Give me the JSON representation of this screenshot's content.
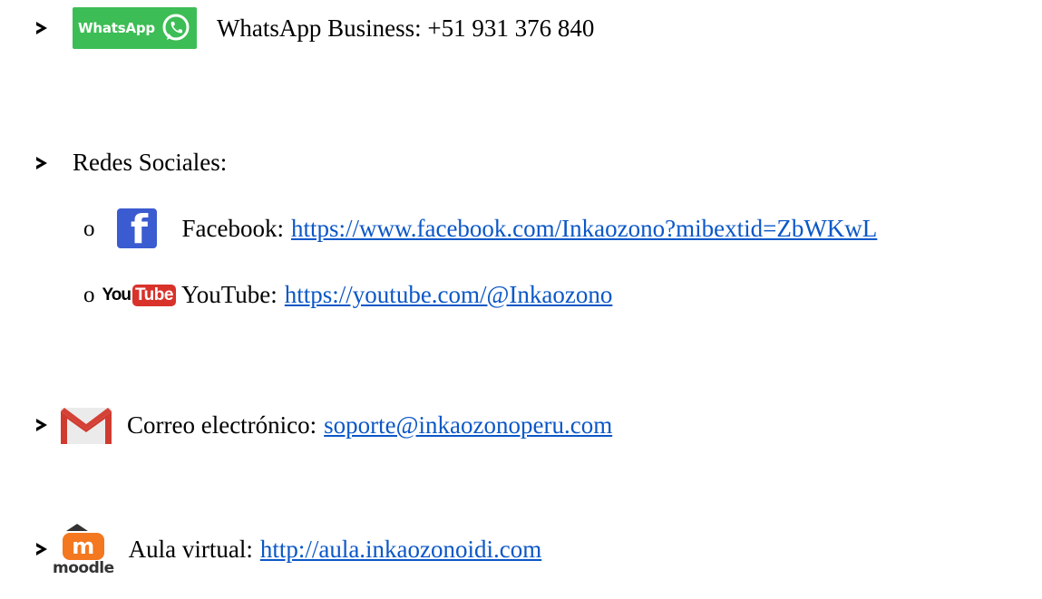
{
  "items": {
    "whatsapp": {
      "badge_label": "WhatsApp",
      "icon": "whatsapp-icon",
      "text": "WhatsApp Business: +51 931 376 840"
    },
    "social": {
      "heading": "Redes Sociales:",
      "sub_bullet": "o",
      "facebook": {
        "icon": "facebook-icon",
        "label": "Facebook:",
        "url": "https://www.facebook.com/Inkaozono?mibextid=ZbWKwL"
      },
      "youtube": {
        "logo_you": "You",
        "logo_tube": "Tube",
        "label": "YouTube:",
        "url": "https://youtube.com/@Inkaozono"
      }
    },
    "email": {
      "icon": "gmail-icon",
      "label": "Correo electrónico:",
      "address": "soporte@inkaozonoperu.com"
    },
    "aula": {
      "logo_glyph": "m",
      "logo_word": "moodle",
      "label": "Aula virtual:",
      "url": "http://aula.inkaozonoidi.com"
    }
  },
  "colors": {
    "link": "#0b57c7",
    "whatsapp_green": "#3dbd55",
    "facebook_blue": "#3b5bd0",
    "youtube_red": "#d8322b",
    "moodle_orange": "#f3781f"
  }
}
